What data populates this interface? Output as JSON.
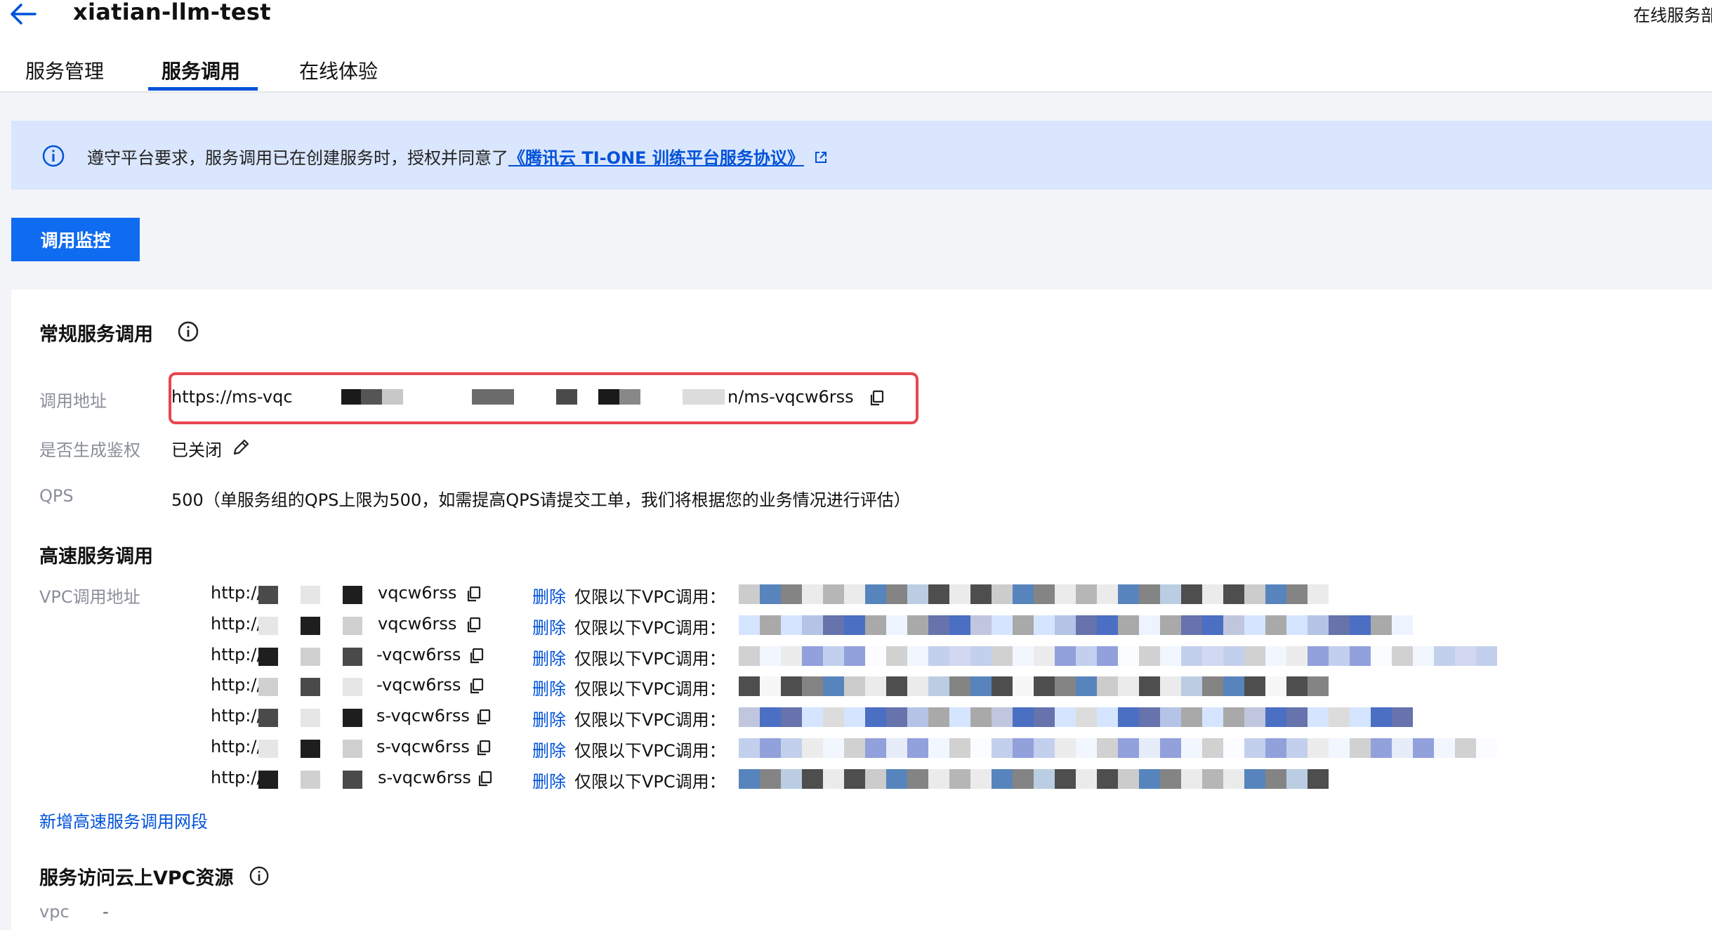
{
  "header": {
    "title": "xiatian-llm-test",
    "right_text": "在线服务部"
  },
  "tabs": [
    {
      "label": "服务管理"
    },
    {
      "label": "服务调用"
    },
    {
      "label": "在线体验"
    }
  ],
  "notice": {
    "text": "遵守平台要求，服务调用已在创建服务时，授权并同意了",
    "link": "《腾讯云 TI-ONE 训练平台服务协议》"
  },
  "monitor_button": "调用监控",
  "regular": {
    "title": "常规服务调用",
    "address_label": "调用地址",
    "address_prefix": "https://ms-vqc",
    "address_suffix": "n/ms-vqcw6rss",
    "auth_label": "是否生成鉴权",
    "auth_value": "已关闭",
    "qps_label": "QPS",
    "qps_value": "500（单服务组的QPS上限为500，如需提高QPS请提交工单，我们将根据您的业务情况进行评估）"
  },
  "highspeed": {
    "title": "高速服务调用",
    "vpc_label": "VPC调用地址",
    "delete_label": "删除",
    "restrict_label": "仅限以下VPC调用：",
    "rows": [
      {
        "prefix": "http://",
        "suffix": "vqcw6rss"
      },
      {
        "prefix": "http://",
        "suffix": "vqcw6rss"
      },
      {
        "prefix": "http://",
        "suffix": "-vqcw6rss"
      },
      {
        "prefix": "http://",
        "suffix": "-vqcw6rss"
      },
      {
        "prefix": "http://",
        "suffix": "s-vqcw6rss"
      },
      {
        "prefix": "http://",
        "suffix": "s-vqcw6rss"
      },
      {
        "prefix": "http://",
        "suffix": "s-vqcw6rss"
      }
    ],
    "add_link": "新增高速服务调用网段"
  },
  "vpc_access": {
    "title": "服务访问云上VPC资源",
    "vpc_label": "vpc",
    "vpc_value": "-"
  },
  "colors": {
    "primary": "#0052d9",
    "button": "#0f6bf0",
    "notice_bg": "#d9e6fd",
    "highlight_border": "#e8464f",
    "page_bg": "#f2f4f8"
  }
}
